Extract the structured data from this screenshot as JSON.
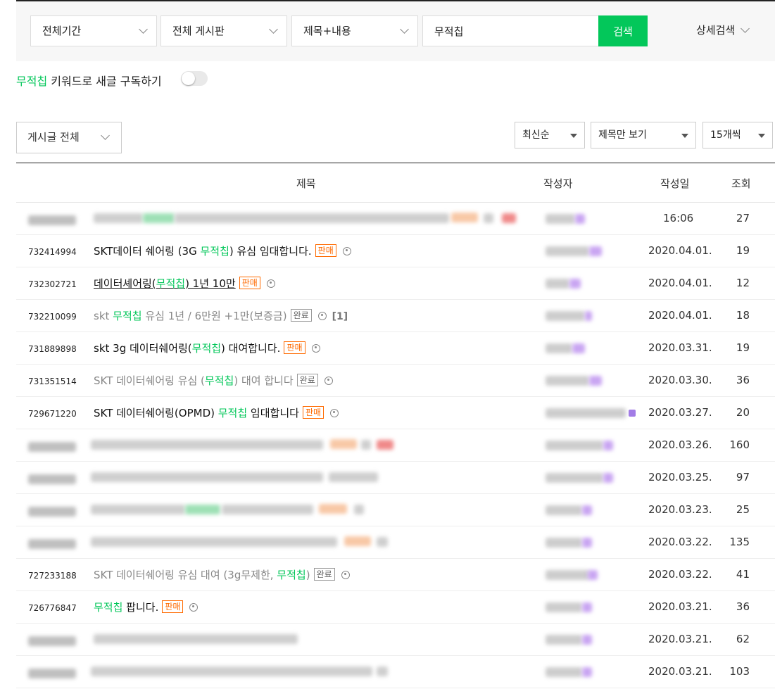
{
  "search": {
    "period": "전체기간",
    "board": "전체 게시판",
    "scope": "제목+내용",
    "query": "무적칩",
    "button_label": "검색",
    "advanced_label": "상세검색"
  },
  "subscribe": {
    "keyword": "무적칩",
    "text": "키워드로 새글 구독하기"
  },
  "list_controls": {
    "post_filter": "게시글 전체",
    "sort": "최신순",
    "view_mode": "제목만 보기",
    "page_size": "15개씩"
  },
  "table": {
    "headers": {
      "title": "제목",
      "author": "작성자",
      "date": "작성일",
      "views": "조회"
    },
    "rows": [
      {
        "date": "16:06",
        "views": "27"
      },
      {
        "num": "732414994",
        "t1": "SKT데이터 쉐어링 (3G ",
        "kw": "무적칩",
        "t2": ") 유심 임대합니다.",
        "tag": "판매",
        "date": "2020.04.01.",
        "views": "19"
      },
      {
        "num": "732302721",
        "t1": "데이터셰어링(",
        "kw": "무적칩",
        "t2": ") 1년 10만",
        "tag": "판매",
        "date": "2020.04.01.",
        "views": "12"
      },
      {
        "num": "732210099",
        "t1": "skt ",
        "kw": "무적칩",
        "t2": " 유심 1년 / 6만원 +1만(보증금)",
        "tag": "완료",
        "comments": "[1]",
        "date": "2020.04.01.",
        "views": "18"
      },
      {
        "num": "731889898",
        "t1": "skt 3g 데이터쉐어링(",
        "kw": "무적칩",
        "t2": ") 대여합니다.",
        "tag": "판매",
        "date": "2020.03.31.",
        "views": "19"
      },
      {
        "num": "731351514",
        "t1": "SKT 데이터쉐어링 유심 (",
        "kw": "무적칩",
        "t2": ") 대여 합니다",
        "tag": "완료",
        "date": "2020.03.30.",
        "views": "36"
      },
      {
        "num": "729671220",
        "t1": "SKT 데이터쉐어링(OPMD) ",
        "kw": "무적칩",
        "t2": " 임대합니다",
        "tag": "판매",
        "date": "2020.03.27.",
        "views": "20"
      },
      {
        "date": "2020.03.26.",
        "views": "160"
      },
      {
        "date": "2020.03.25.",
        "views": "97"
      },
      {
        "date": "2020.03.23.",
        "views": "25"
      },
      {
        "date": "2020.03.22.",
        "views": "135"
      },
      {
        "num": "727233188",
        "t1": "SKT 데이터쉐어링 유심 대여 (3g무제한, ",
        "kw": "무적칩",
        "t2": ")",
        "tag": "완료",
        "date": "2020.03.22.",
        "views": "41"
      },
      {
        "num": "726776847",
        "t1": "",
        "kw": "무적칩",
        "t2": " 팝니다.",
        "tag": "판매",
        "date": "2020.03.21.",
        "views": "36"
      },
      {
        "date": "2020.03.21.",
        "views": "62"
      },
      {
        "date": "2020.03.21.",
        "views": "103"
      }
    ]
  }
}
